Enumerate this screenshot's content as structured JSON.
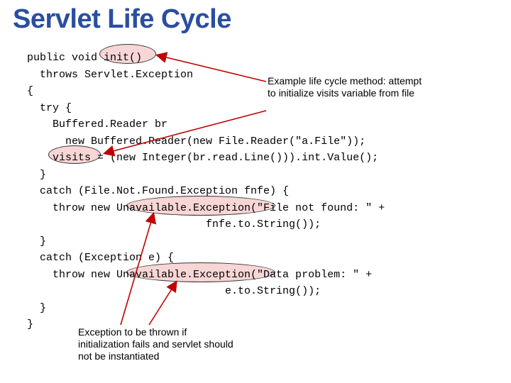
{
  "title": "Servlet Life Cycle",
  "annotations": {
    "top": "Example life cycle method: attempt to initialize visits variable from file",
    "bottom": "Exception to be thrown if initialization fails and servlet should not be instantiated"
  },
  "code": {
    "l1": "public void init()",
    "l2": "  throws Servlet.Exception",
    "l3": "{",
    "l4": "  try {",
    "l5": "    Buffered.Reader br",
    "l6": "      new Buffered.Reader(new File.Reader(\"a.File\"));",
    "l7": "    visits = (new Integer(br.read.Line())).int.Value();",
    "l8": "  }",
    "l9": "  catch (File.Not.Found.Exception fnfe) {",
    "l10": "    throw new Unavailable.Exception(\"File not found: \" +",
    "l11": "                            fnfe.to.String());",
    "l12": "  }",
    "l13": "  catch (Exception e) {",
    "l14": "    throw new Unavailable.Exception(\"Data problem: \" +",
    "l15": "                               e.to.String());",
    "l16": "  }",
    "l17": "}"
  }
}
